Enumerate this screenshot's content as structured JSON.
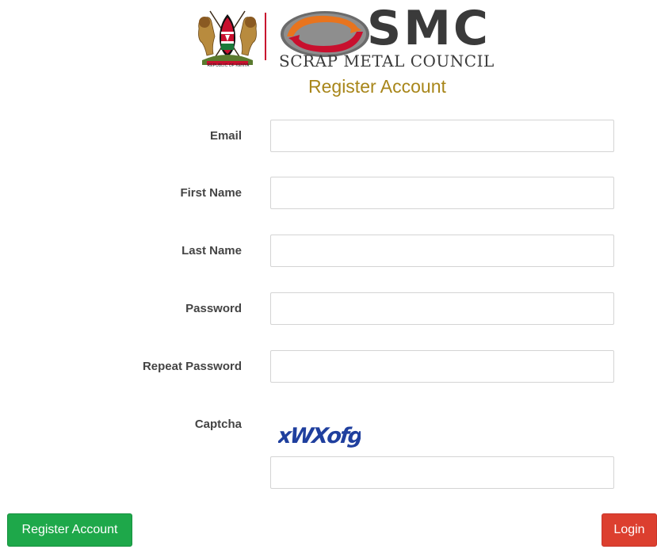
{
  "header": {
    "coat_of_arms_caption": "REPUBLIC OF KENYA",
    "brand_wordmark": "SMC",
    "brand_subtitle": "SCRAP METAL COUNCIL",
    "page_title": "Register Account"
  },
  "form": {
    "fields": [
      {
        "label": "Email",
        "value": "",
        "type": "email"
      },
      {
        "label": "First Name",
        "value": "",
        "type": "text"
      },
      {
        "label": "Last Name",
        "value": "",
        "type": "text"
      },
      {
        "label": "Password",
        "value": "",
        "type": "password"
      },
      {
        "label": "Repeat Password",
        "value": "",
        "type": "password"
      }
    ],
    "captcha": {
      "label": "Captcha",
      "image_text": "xWXofg",
      "value": ""
    }
  },
  "buttons": {
    "register_label": "Register Account",
    "login_label": "Login"
  },
  "colors": {
    "title": "#a8861a",
    "register_button": "#1ea84a",
    "login_button": "#dc3f2f",
    "captcha_text": "#1f3f9e",
    "emblem_orange": "#e8741e",
    "emblem_red": "#c8102e"
  },
  "icons": {
    "coat_of_arms": "kenya-coat-of-arms-icon",
    "emblem": "smc-recycle-emblem-icon"
  }
}
